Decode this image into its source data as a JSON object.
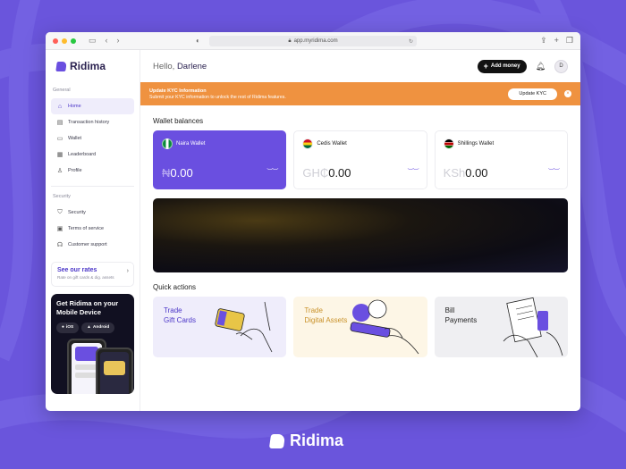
{
  "browser": {
    "url": "app.myridima.com"
  },
  "brand": {
    "name": "Ridima",
    "accent": "#6a4fe0",
    "background": "#6a55dc"
  },
  "sidebar": {
    "general_label": "General",
    "items": [
      {
        "label": "Home",
        "icon": "home-icon"
      },
      {
        "label": "Transaction history",
        "icon": "receipt-icon"
      },
      {
        "label": "Wallet",
        "icon": "wallet-icon"
      },
      {
        "label": "Leaderboard",
        "icon": "chart-icon"
      },
      {
        "label": "Profile",
        "icon": "user-icon"
      }
    ],
    "security_label": "Security",
    "security_items": [
      {
        "label": "Security",
        "icon": "shield-icon"
      },
      {
        "label": "Terms of service",
        "icon": "document-icon"
      },
      {
        "label": "Customer support",
        "icon": "headset-icon"
      }
    ],
    "rates": {
      "title": "See our rates",
      "subtitle": "Rate on gift cards & dig. assets"
    },
    "promo": {
      "title": "Get Ridima on your Mobile Device",
      "ios": "iOS",
      "android": "Android"
    }
  },
  "header": {
    "greeting": "Hello,",
    "user_name": "Darlene",
    "add_money": "Add money",
    "avatar_initial": "D"
  },
  "kyc_banner": {
    "title": "Update KYC Information",
    "subtitle": "Submit your KYC information to unlock the rest of Ridima features.",
    "button": "Update KYC",
    "color": "#ef9240"
  },
  "wallets": {
    "title": "Wallet balances",
    "items": [
      {
        "name": "Naira Wallet",
        "symbol": "₦",
        "amount": "0.00"
      },
      {
        "name": "Cedis Wallet",
        "symbol": "GH₵",
        "amount": "0.00"
      },
      {
        "name": "Shillings Wallet",
        "symbol": "KSh",
        "amount": "0.00"
      }
    ]
  },
  "quick_actions": {
    "title": "Quick actions",
    "items": [
      {
        "line1": "Trade",
        "line2": "Gift Cards",
        "color": "#efedfb",
        "text_color": "#4b36c8"
      },
      {
        "line1": "Trade",
        "line2": "Digital Assets",
        "color": "#fdf6e6",
        "text_color": "#c9922a"
      },
      {
        "line1": "Bill",
        "line2": "Payments",
        "color": "#efeff2",
        "text_color": "#222222"
      }
    ]
  },
  "footer": {
    "brand": "Ridima"
  }
}
